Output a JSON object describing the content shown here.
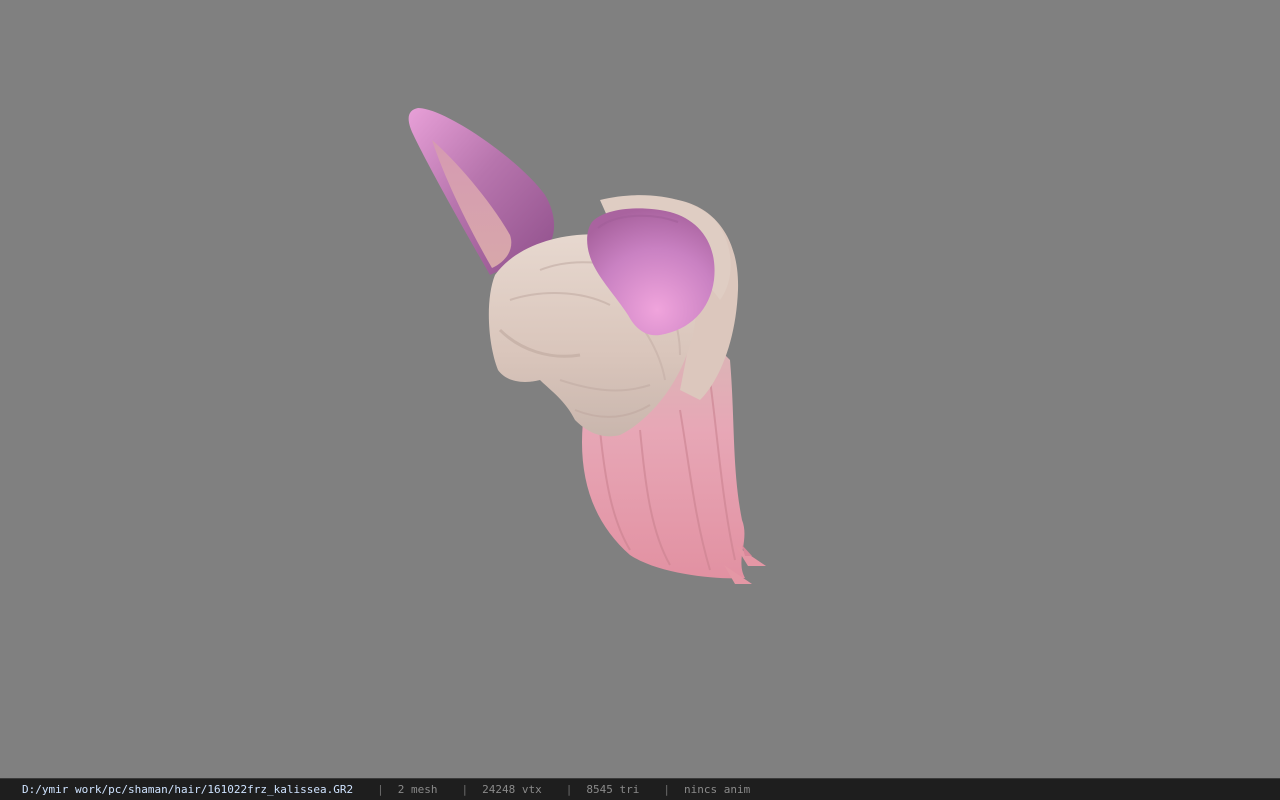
{
  "viewport": {
    "background": "#808080",
    "model": {
      "object": "hair-with-bunny-ears",
      "colors": {
        "ear_outer": "#b06fa8",
        "ear_outer_highlight": "#e8a0d8",
        "ear_inner": "#d7a3b2",
        "hair_top": "#e0cfc4",
        "hair_shadow": "#c7b4aa",
        "hair_strands": "#e8a7b4",
        "hair_strands_tip": "#e497a5"
      }
    }
  },
  "statusbar": {
    "file_path": "D:/ymir work/pc/shaman/hair/161022frz_kalissea.GR2",
    "mesh_count": "2 mesh",
    "vertex_count": "24248 vtx",
    "triangle_count": "8545 tri",
    "anim_status": "nincs anim",
    "separator": "|"
  }
}
